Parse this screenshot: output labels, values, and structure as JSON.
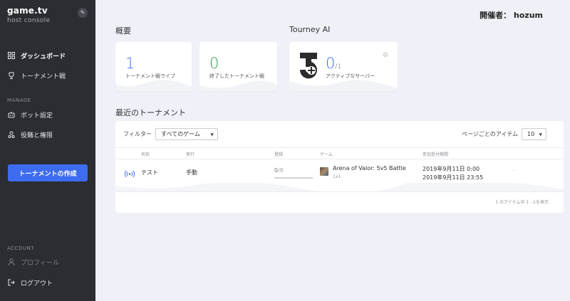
{
  "sidebar": {
    "brand": "game.tv",
    "subtitle": "host console",
    "items": [
      {
        "label": "ダッシュボード",
        "icon": "dashboard-icon"
      },
      {
        "label": "トーナメント戦",
        "icon": "trophy-icon"
      }
    ],
    "manage_label": "MANAGE",
    "manage_items": [
      {
        "label": "ボット設定",
        "icon": "robot-icon"
      },
      {
        "label": "役職と権限",
        "icon": "roles-icon"
      }
    ],
    "create_button": "トーナメントの作成",
    "account_label": "ACCOUNT",
    "account_items": [
      {
        "label": "プロフィール",
        "icon": "user-icon"
      },
      {
        "label": "ログアウト",
        "icon": "logout-icon"
      }
    ]
  },
  "header": {
    "host": "開催者： hozum"
  },
  "overview": {
    "title": "概要",
    "cards": [
      {
        "value": "1",
        "label": "トーナメント戦ライブ",
        "color": "#3d6cf1"
      },
      {
        "value": "0",
        "label": "終了したトーナメント戦",
        "color": "#2f9e4f"
      }
    ]
  },
  "tourney_ai": {
    "title": "Tourney AI",
    "value": "0",
    "total": "/1",
    "label": "アクティブなサーバー",
    "color": "#3d6cf1"
  },
  "recent": {
    "title": "最近のトーナメント",
    "filter_label": "フィルター",
    "filter_value": "すべてのゲーム",
    "per_page_label": "ページごとのアイテム",
    "per_page_value": "10",
    "columns": [
      "名前",
      "実行",
      "登録",
      "ゲーム",
      "参加受付期間"
    ],
    "rows": [
      {
        "name": "テスト",
        "run": "手動",
        "registered": "0",
        "capacity": "/8",
        "registration_fill": 0,
        "game": "Arena of Valor: 5v5 Battle",
        "format": "1x1",
        "start": "2019年9月11日 0:00",
        "end": "2019年9月11日 23:55"
      }
    ],
    "footer": "1 のアイテム中 1 - 1を表示"
  }
}
